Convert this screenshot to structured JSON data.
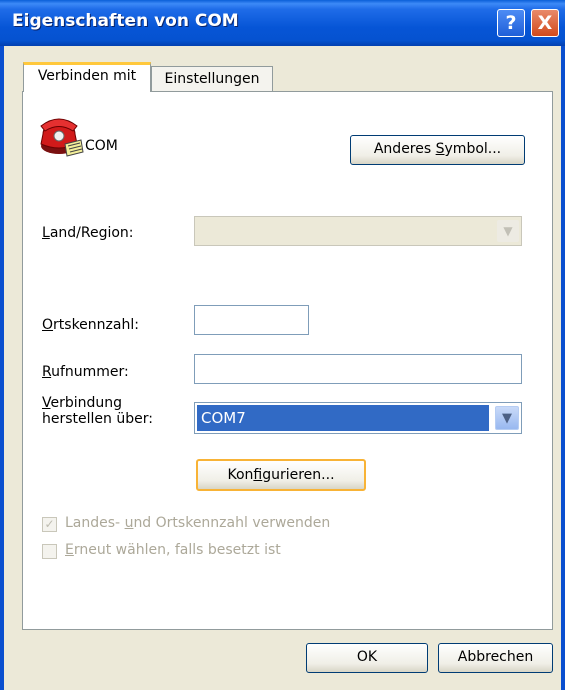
{
  "window": {
    "title": "Eigenschaften von COM",
    "help_glyph": "?",
    "close_glyph": "X"
  },
  "tabs": [
    {
      "label": "Verbinden mit",
      "selected": true
    },
    {
      "label": "Einstellungen",
      "selected": false
    }
  ],
  "connection": {
    "icon": "phone-icon",
    "name": "COM",
    "change_icon_label_pre": "Anderes ",
    "change_icon_label_key": "S",
    "change_icon_label_post": "ymbol..."
  },
  "fields": {
    "country": {
      "label_key": "L",
      "label_rest": "and/Region:",
      "value": ""
    },
    "area_code": {
      "label_key": "O",
      "label_rest": "rtskennzahl:",
      "value": ""
    },
    "phone": {
      "label_key": "R",
      "label_rest": "ufnummer:",
      "value": ""
    },
    "connect_via": {
      "label_key": "V",
      "label_line1_rest": "erbindung",
      "label_line2": "herstellen über:",
      "value": "COM7"
    }
  },
  "configure_button": {
    "pre": "Kon",
    "key": "f",
    "post": "igurieren..."
  },
  "checkboxes": [
    {
      "pre": "Landes- ",
      "key": "u",
      "post": "nd Ortskennzahl verwenden",
      "checked": true,
      "enabled": false
    },
    {
      "pre": "",
      "key": "E",
      "post": "rneut wählen, falls besetzt ist",
      "checked": false,
      "enabled": false
    }
  ],
  "buttons": {
    "ok": "OK",
    "cancel": "Abbrechen"
  },
  "colors": {
    "selection": "#316AC5",
    "title_bar": "#0A5FD8",
    "tab_highlight": "#FFC83C"
  }
}
